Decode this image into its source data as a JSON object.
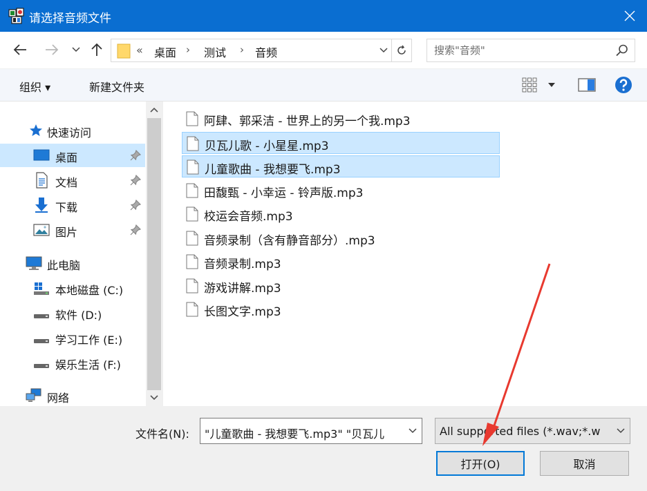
{
  "window": {
    "title": "请选择音频文件"
  },
  "address": {
    "overflow": "«",
    "crumbs": [
      "桌面",
      "测试",
      "音频"
    ]
  },
  "search": {
    "placeholder": "搜索\"音频\""
  },
  "toolbar": {
    "organize_label": "组织 ▾",
    "new_folder_label": "新建文件夹"
  },
  "sidebar": {
    "items": [
      {
        "label": "快速访问",
        "icon": "star-icon"
      },
      {
        "label": "桌面",
        "icon": "desktop-icon",
        "pinned": true,
        "selected": true
      },
      {
        "label": "文档",
        "icon": "document-icon",
        "pinned": true
      },
      {
        "label": "下载",
        "icon": "download-icon",
        "pinned": true
      },
      {
        "label": "图片",
        "icon": "pictures-icon",
        "pinned": true
      },
      {
        "label": "此电脑",
        "icon": "computer-icon"
      },
      {
        "label": "本地磁盘 (C:)",
        "icon": "windows-drive-icon"
      },
      {
        "label": "软件 (D:)",
        "icon": "drive-icon"
      },
      {
        "label": "学习工作 (E:)",
        "icon": "drive-icon"
      },
      {
        "label": "娱乐生活 (F:)",
        "icon": "drive-icon"
      },
      {
        "label": "网络",
        "icon": "network-icon"
      }
    ]
  },
  "files": [
    {
      "name": "阿肆、郭采洁 - 世界上的另一个我.mp3",
      "selected": false
    },
    {
      "name": "贝瓦儿歌 - 小星星.mp3",
      "selected": true
    },
    {
      "name": "儿童歌曲 - 我想要飞.mp3",
      "selected": true
    },
    {
      "name": "田馥甄 - 小幸运 - 铃声版.mp3",
      "selected": false
    },
    {
      "name": "校运会音频.mp3",
      "selected": false
    },
    {
      "name": "音频录制（含有静音部分）.mp3",
      "selected": false
    },
    {
      "name": "音频录制.mp3",
      "selected": false
    },
    {
      "name": "游戏讲解.mp3",
      "selected": false
    },
    {
      "name": "长图文字.mp3",
      "selected": false
    }
  ],
  "bottom": {
    "filename_label": "文件名(N):",
    "filename_value": "\"儿童歌曲 - 我想要飞.mp3\" \"贝瓦儿",
    "filetype_value": "All supported files (*.wav;*.w",
    "open_label": "打开(O)",
    "cancel_label": "取消"
  },
  "colors": {
    "titlebar": "#0a6ed1",
    "selection": "#cce8ff",
    "annotation_arrow": "#e8392f"
  }
}
